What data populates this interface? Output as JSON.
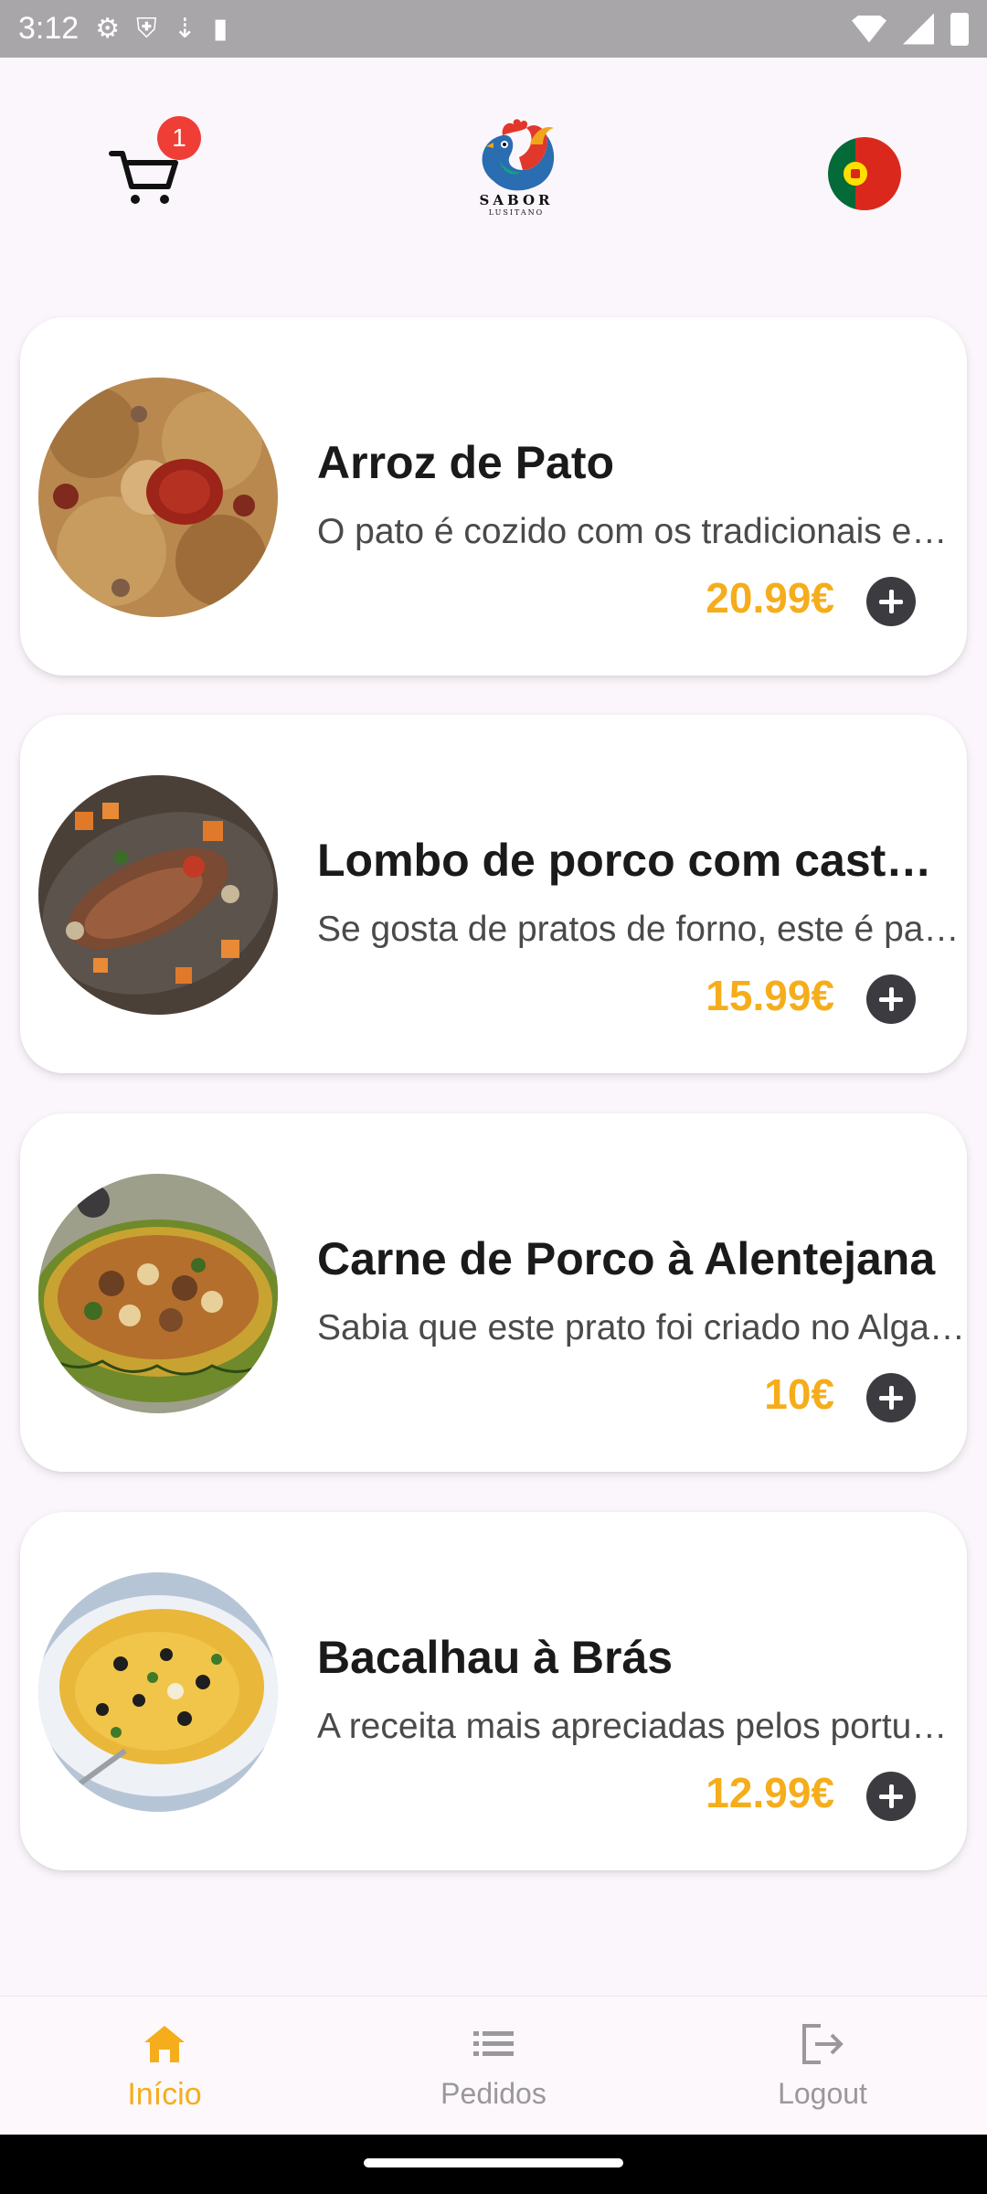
{
  "status_bar": {
    "time": "3:12"
  },
  "header": {
    "cart_badge_count": "1",
    "logo_text": "SABOR",
    "logo_subtext": "LUSITANO"
  },
  "products": [
    {
      "name": "Arroz de Pato",
      "description": "O pato é cozido com os tradicionais enchidos portugueses",
      "price": "20.99€"
    },
    {
      "name": "Lombo de porco com castanhas",
      "description": "Se gosta de pratos de forno, este é para si",
      "price": "15.99€"
    },
    {
      "name": "Carne de Porco à Alentejana",
      "description": "Sabia que este prato foi criado no Algarve",
      "price": "10€"
    },
    {
      "name": "Bacalhau à Brás",
      "description": "A receita mais apreciadas pelos portugueses",
      "price": "12.99€"
    }
  ],
  "nav": {
    "home_label": "Início",
    "orders_label": "Pedidos",
    "logout_label": "Logout"
  },
  "colors": {
    "accent": "#f5ad1b",
    "badge": "#ef3e36",
    "add_button": "#3c3b3f"
  }
}
